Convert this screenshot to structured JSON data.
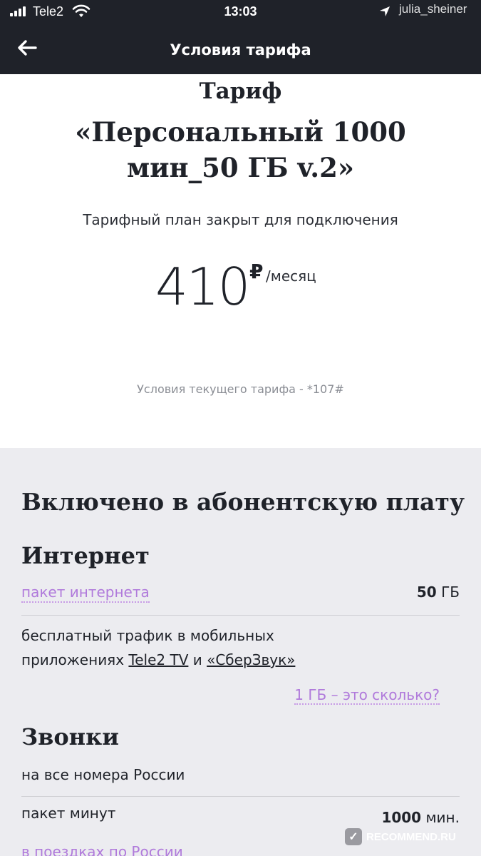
{
  "status_bar": {
    "carrier": "Tele2",
    "time": "13:03",
    "watermark": "julia_sheiner"
  },
  "nav": {
    "title": "Условия тарифа",
    "back_icon": "arrow-left-icon"
  },
  "hero": {
    "label": "Тариф",
    "name": "«Персональный 1000 мин_50 ГБ v.2»",
    "closed_note": "Тарифный план закрыт для подключения",
    "price": "410",
    "currency": "₽",
    "period": "/месяц",
    "current_terms": "Условия текущего тарифа - *107#"
  },
  "included": {
    "heading": "Включено в абонентскую плату",
    "internet": {
      "heading": "Интернет",
      "package_label": "пакет интернета",
      "package_value": "50",
      "package_unit": " ГБ",
      "free_traffic_line1": "бесплатный трафик в мобильных",
      "free_traffic_prefix": "приложениях ",
      "free_traffic_app1": "Tele2 TV",
      "free_traffic_and": " и ",
      "free_traffic_app2": "«СберЗвук»",
      "gb_link": "1 ГБ – это сколько?"
    },
    "calls": {
      "heading": "Звонки",
      "all_numbers": "на все номера России",
      "minutes_label": "пакет минут",
      "minutes_value": "1000",
      "minutes_unit": " мин.",
      "travel_link": "в поездках по России"
    }
  },
  "watermark_bottom": "RECOMMEND.RU",
  "colors": {
    "topbar": "#1f2229",
    "accent_link": "#b07adb",
    "section_bg": "#ececf0"
  }
}
